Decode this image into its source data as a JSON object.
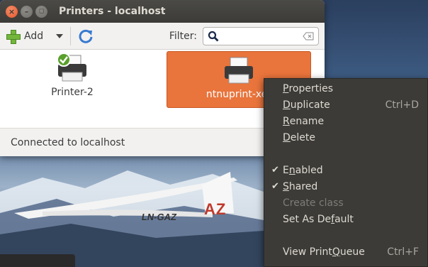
{
  "window": {
    "title": "Printers - localhost",
    "close_glyph": "×",
    "minimize_glyph": "–",
    "maximize_glyph": "◻"
  },
  "toolbar": {
    "add_label": "Add",
    "filter_label": "Filter:",
    "filter_value": "",
    "filter_placeholder": ""
  },
  "printers": [
    {
      "name": "Printer-2",
      "default": true,
      "selected": false
    },
    {
      "name": "ntnuprint-xer",
      "default": false,
      "selected": true
    }
  ],
  "status": {
    "text": "Connected to localhost"
  },
  "context_menu": {
    "items": [
      {
        "pre": "",
        "mn": "P",
        "post": "roperties",
        "accel": "",
        "checked": false,
        "enabled": true
      },
      {
        "pre": "",
        "mn": "D",
        "post": "uplicate",
        "accel": "Ctrl+D",
        "checked": false,
        "enabled": true
      },
      {
        "pre": "",
        "mn": "R",
        "post": "ename",
        "accel": "",
        "checked": false,
        "enabled": true
      },
      {
        "pre": "",
        "mn": "D",
        "post": "elete",
        "accel": "",
        "checked": false,
        "enabled": true
      },
      {
        "pre": "E",
        "mn": "n",
        "post": "abled",
        "accel": "",
        "checked": true,
        "enabled": true
      },
      {
        "pre": "",
        "mn": "S",
        "post": "hared",
        "accel": "",
        "checked": true,
        "enabled": true
      },
      {
        "pre": "",
        "mn": "",
        "post": "Create class",
        "accel": "",
        "checked": false,
        "enabled": false
      },
      {
        "pre": "Set As De",
        "mn": "f",
        "post": "ault",
        "accel": "",
        "checked": false,
        "enabled": true
      },
      {
        "pre": "View Print ",
        "mn": "Q",
        "post": "ueue",
        "accel": "Ctrl+F",
        "checked": false,
        "enabled": true
      }
    ]
  },
  "wallpaper": {
    "tail_text": "AZ",
    "registration": "LN-GAZ"
  },
  "colors": {
    "accent": "#e9743c",
    "menu_bg": "#3c3b37",
    "titlebar": "#3c3b37",
    "close": "#e4572e"
  }
}
